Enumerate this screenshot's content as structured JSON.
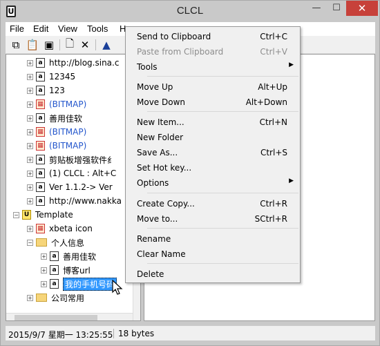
{
  "window": {
    "title": "CLCL",
    "minimize": "—",
    "maximize": "☐",
    "close": "✕"
  },
  "menubar": {
    "items": [
      "File",
      "Edit",
      "View",
      "Tools",
      "He"
    ]
  },
  "toolbar": {
    "icons": [
      "copy-icon",
      "paste-icon",
      "clipboard-icon",
      "new-icon",
      "delete-icon",
      "up-icon"
    ]
  },
  "tree": {
    "items": [
      {
        "label": "http://blog.sina.c",
        "kind": "text"
      },
      {
        "label": "12345",
        "kind": "text"
      },
      {
        "label": "123",
        "kind": "text"
      },
      {
        "label": "(BITMAP)",
        "kind": "bitmap"
      },
      {
        "label": "善用佳软",
        "kind": "text"
      },
      {
        "label": "(BITMAP)",
        "kind": "bitmap"
      },
      {
        "label": "(BITMAP)",
        "kind": "bitmap"
      },
      {
        "label": "剪贴板增强软件纟",
        "kind": "text"
      },
      {
        "label": "(1) CLCL : Alt+C",
        "kind": "text"
      },
      {
        "label": "Ver 1.1.2-> Ver",
        "kind": "text"
      },
      {
        "label": "http://www.nakka",
        "kind": "text"
      },
      {
        "label": "Template",
        "kind": "template"
      },
      {
        "label": "xbeta icon",
        "kind": "bitmap-text"
      },
      {
        "label": "个人信息",
        "kind": "folder"
      },
      {
        "label": "善用佳软",
        "kind": "text"
      },
      {
        "label": "博客url",
        "kind": "text"
      },
      {
        "label": "我的手机号码",
        "kind": "text",
        "selected": true
      },
      {
        "label": "公司常用",
        "kind": "folder"
      }
    ]
  },
  "status": {
    "datetime": "2015/9/7 星期一 13:25:55",
    "size": "18 bytes"
  },
  "context_menu": {
    "items": [
      {
        "label": "Send to Clipboard",
        "shortcut": "Ctrl+C"
      },
      {
        "label": "Paste from Clipboard",
        "shortcut": "Ctrl+V",
        "disabled": true
      },
      {
        "label": "Tools",
        "submenu": true
      },
      {
        "label": "Move Up",
        "shortcut": "Alt+Up"
      },
      {
        "label": "Move Down",
        "shortcut": "Alt+Down"
      },
      {
        "label": "New Item...",
        "shortcut": "Ctrl+N"
      },
      {
        "label": "New Folder"
      },
      {
        "label": "Save As...",
        "shortcut": "Ctrl+S"
      },
      {
        "label": "Set Hot key..."
      },
      {
        "label": "Options",
        "submenu": true
      },
      {
        "label": "Create Copy...",
        "shortcut": "Ctrl+R"
      },
      {
        "label": "Move to...",
        "shortcut": "SCtrl+R"
      },
      {
        "label": "Rename"
      },
      {
        "label": "Clear Name"
      },
      {
        "label": "Delete"
      }
    ]
  }
}
